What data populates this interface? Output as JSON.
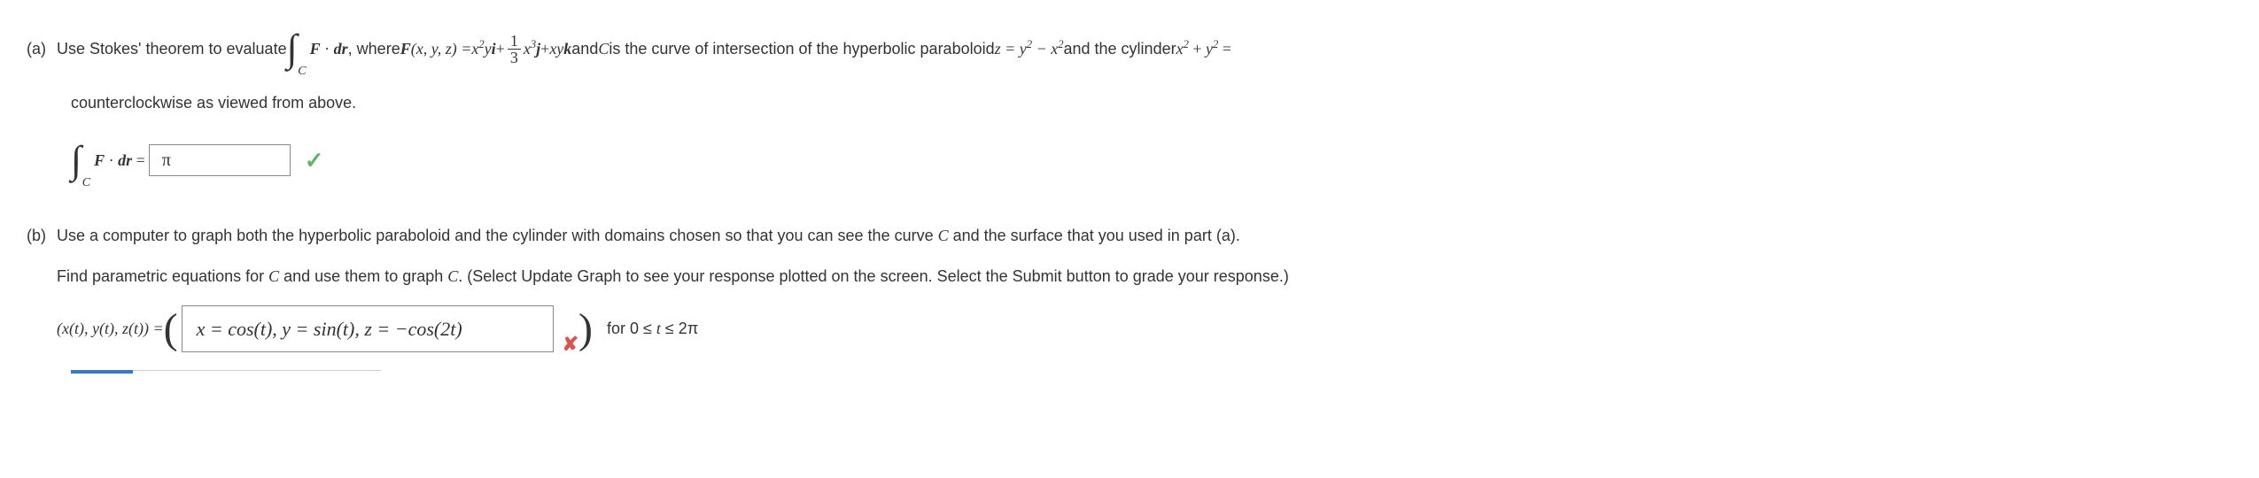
{
  "partA": {
    "label": "(a)",
    "text1": "Use Stokes' theorem to evaluate ",
    "int_sub": "C",
    "integrand": " · ",
    "F": "F",
    "dr": "dr",
    "text2": ", where ",
    "F_def_lhs": "F(x, y, z) = ",
    "term1_coef": "x",
    "term1_exp": "2",
    "term1_var": "y",
    "i": "i",
    "plus1": " + ",
    "frac_num": "1",
    "frac_den": "3",
    "term2_coef": "x",
    "term2_exp": "3",
    "j": "j",
    "plus2": " + ",
    "term3": "xy",
    "k": "k",
    "text3": " and ",
    "C": "C",
    "text4": " is the curve of intersection of the hyperbolic paraboloid ",
    "surf1": "z = y",
    "surf1_exp1": "2",
    "surf1_mid": " − x",
    "surf1_exp2": "2",
    "text5": " and the cylinder ",
    "cyl1": "x",
    "cyl1_exp": "2",
    "cyl_plus": " + ",
    "cyl2": "y",
    "cyl2_exp": "2",
    "cyl_eq": " =",
    "line2": "counterclockwise as viewed from above.",
    "ans_lhs_F": "F",
    "ans_lhs_dot": " · ",
    "ans_lhs_dr": "dr",
    "ans_lhs_eq": " = ",
    "answer": "π"
  },
  "partB": {
    "label": "(b)",
    "text1": "Use a computer to graph both the hyperbolic paraboloid and the cylinder with domains chosen so that you can see the curve ",
    "C1": "C",
    "text1b": " and the surface that you used in part (a).",
    "text2": "Find parametric equations for ",
    "C2": "C",
    "text2b": " and use them to graph ",
    "C3": "C",
    "text2c": ". (Select Update Graph to see your response plotted on the screen. Select the Submit button to grade your response.)",
    "lhs": "(x(t), y(t), z(t)) = ",
    "answer": "x = cos(t), y = sin(t), z = −cos(2t)",
    "text3a": "for 0 ≤ ",
    "t": "t",
    "text3b": " ≤ 2π"
  }
}
